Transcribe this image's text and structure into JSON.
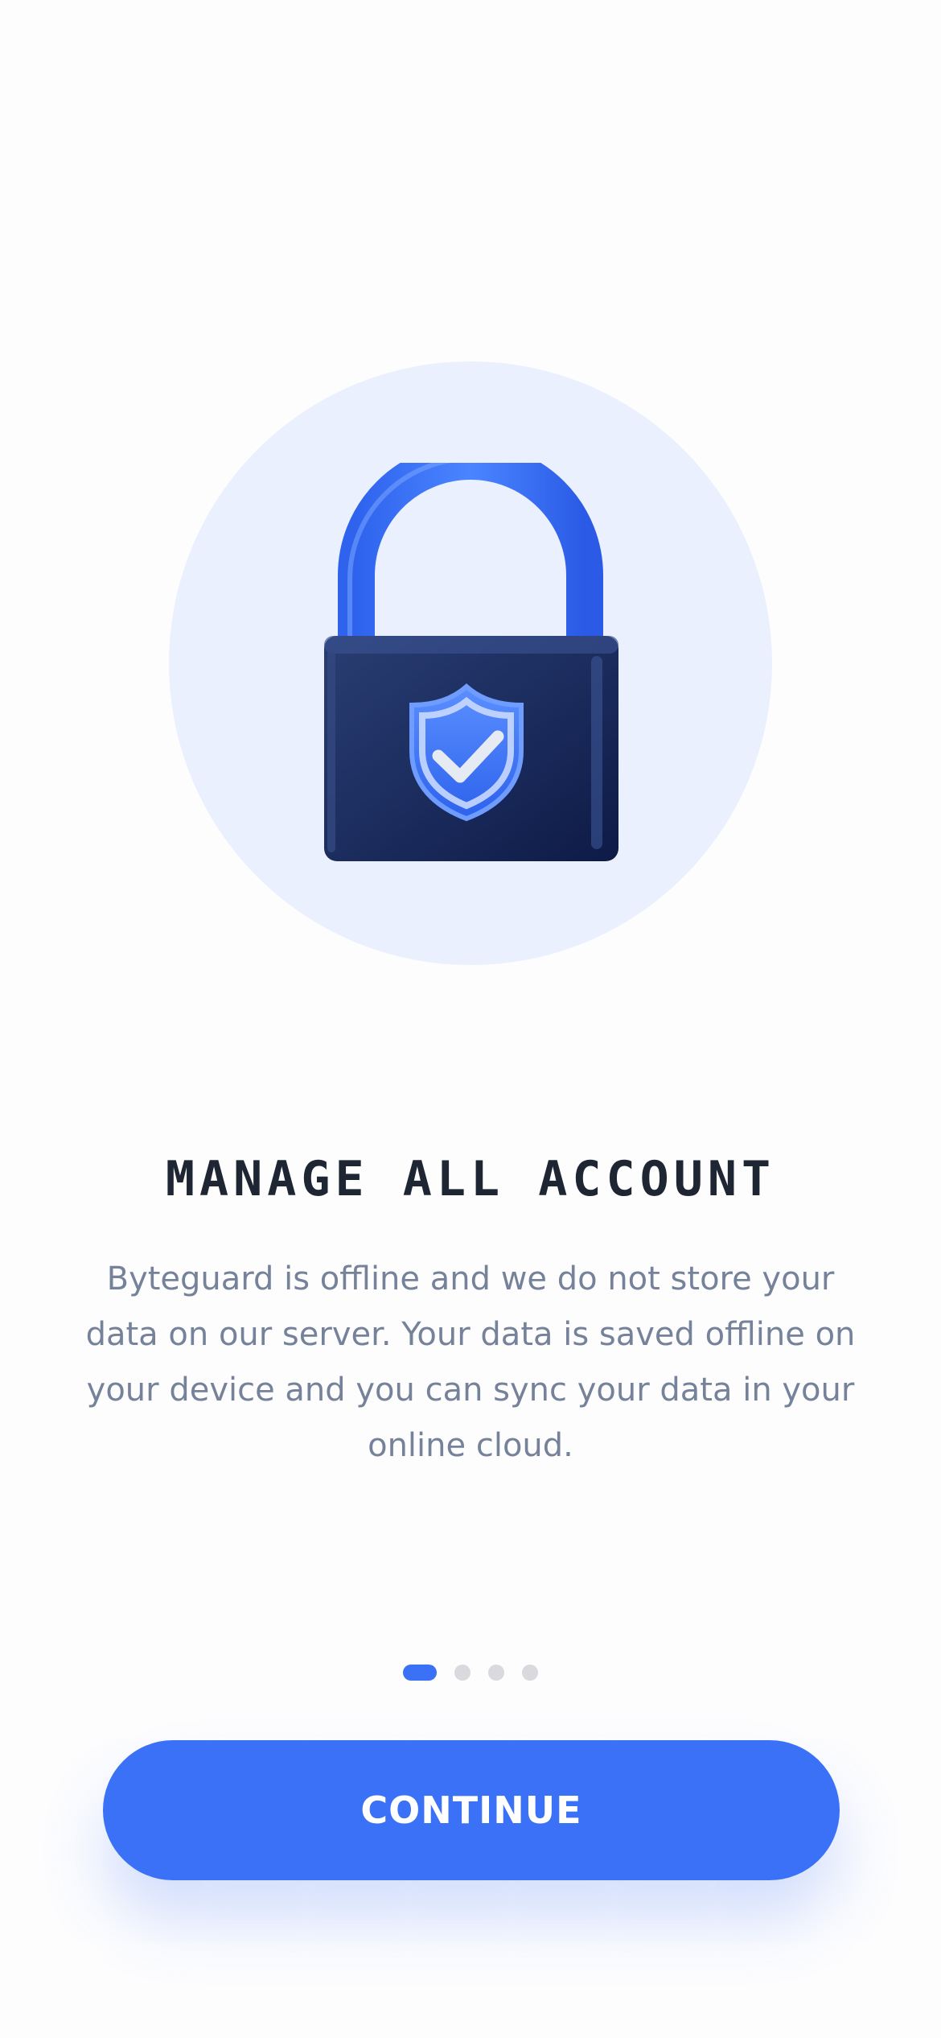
{
  "onboarding": {
    "illustration": {
      "icon": "padlock-shield-check-icon",
      "background_color": "#eaf0fd"
    },
    "title": "MANAGE ALL ACCOUNT",
    "description": "Byteguard is offline and we do not store your data on our server. Your data is saved offline on your device and you can sync your data in your online cloud.",
    "pager": {
      "total_pages": 4,
      "current_page": 1
    },
    "continue_label": "CONTINUE"
  },
  "colors": {
    "accent": "#3a71f6",
    "title": "#1f2633",
    "body_text": "#75829a",
    "inactive_dot": "#d9d9de"
  }
}
